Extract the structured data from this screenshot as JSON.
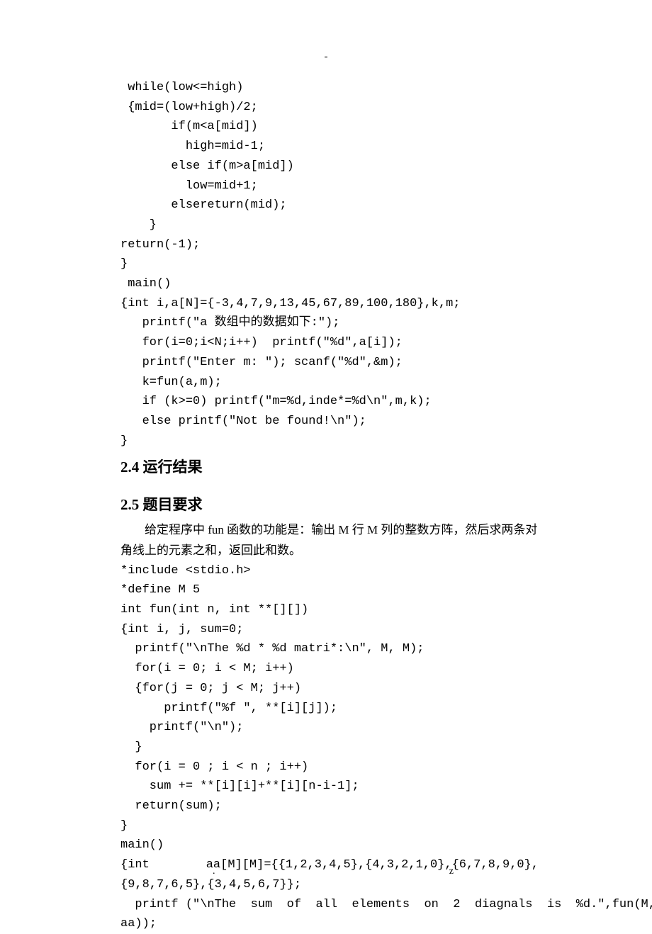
{
  "topmark": "-",
  "code1": " while(low<=high)\n {mid=(low+high)/2;\n       if(m<a[mid])\n         high=mid-1;\n       else if(m>a[mid])\n         low=mid+1;\n       elsereturn(mid);\n    }\nreturn(-1);\n}\n main()\n{int i,a[N]={-3,4,7,9,13,45,67,89,100,180},k,m;\n   printf(\"a 数组中的数据如下:\");\n   for(i=0;i<N;i++)  printf(\"%d\",a[i]);\n   printf(\"Enter m: \"); scanf(\"%d\",&m);\n   k=fun(a,m);\n   if (k>=0) printf(\"m=%d,inde*=%d\\n\",m,k);\n   else printf(\"Not be found!\\n\");\n}",
  "h24": "2.4 运行结果",
  "h25": "2.5 题目要求",
  "body": "给定程序中 fun 函数的功能是：输出 M 行 M 列的整数方阵，然后求两条对角线上的元素之和，返回此和数。",
  "code2a": "*include <stdio.h>\n*define M 5\nint fun(int n, int **[][])\n{int i, j, sum=0;\n  printf(\"\\nThe %d * %d matri*:\\n\", M, M);\n  for(i = 0; i < M; i++)\n  {for(j = 0; j < M; j++)\n      printf(\"%f \", **[i][j]);\n    printf(\"\\n\");\n  }\n  for(i = 0 ; i < n ; i++)\n    sum += **[i][i]+**[i][n-i-1];\n  return(sum);\n}\nmain()",
  "wide1_left": "{int",
  "wide1_right": "aa[M][M]={{1,2,3,4,5},{4,3,2,1,0},{6,7,8,9,0},",
  "code2b": "{9,8,7,6,5},{3,4,5,6,7}};\n  printf (\"\\nThe  sum  of  all  elements  on  2  diagnals  is  %d.\",fun(M,\naa));",
  "footer_left": ".",
  "footer_right": "z"
}
